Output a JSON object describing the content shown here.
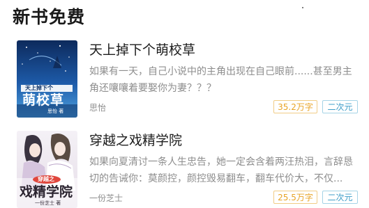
{
  "section": {
    "title": "新书免费"
  },
  "books": [
    {
      "title": "天上掉下个萌校草",
      "description": "如果有一天，自己小说中的主角出现在自己眼前......甚至男主角还嚷嚷着要娶你为妻？？？",
      "author": "思怡",
      "word_count": "35.2万字",
      "category": "二次元",
      "cover": {
        "title_text": "萌校草",
        "subtitle_text": "天上掉下个",
        "author_text": "思怡 著",
        "icon": "book-cover-night-sky"
      }
    },
    {
      "title": "穿越之戏精学院",
      "description": "如果向夏清讨一条人生忠告，她一定会含着两汪热泪，言辞恳切的告诫你：莫颜控，颜控毁易翻车，翻车代价大，不仅...",
      "author": "一份芝士",
      "word_count": "25.5万字",
      "category": "二次元",
      "cover": {
        "title_text": "戏精学院",
        "subtitle_text": "穿越之",
        "author_text": "一份芝士 著",
        "icon": "book-cover-anime-couple"
      }
    }
  ],
  "colors": {
    "word_count_tag": "#e8a325",
    "category_tag": "#3e9dc8",
    "secondary_text": "#8d8d8d"
  }
}
